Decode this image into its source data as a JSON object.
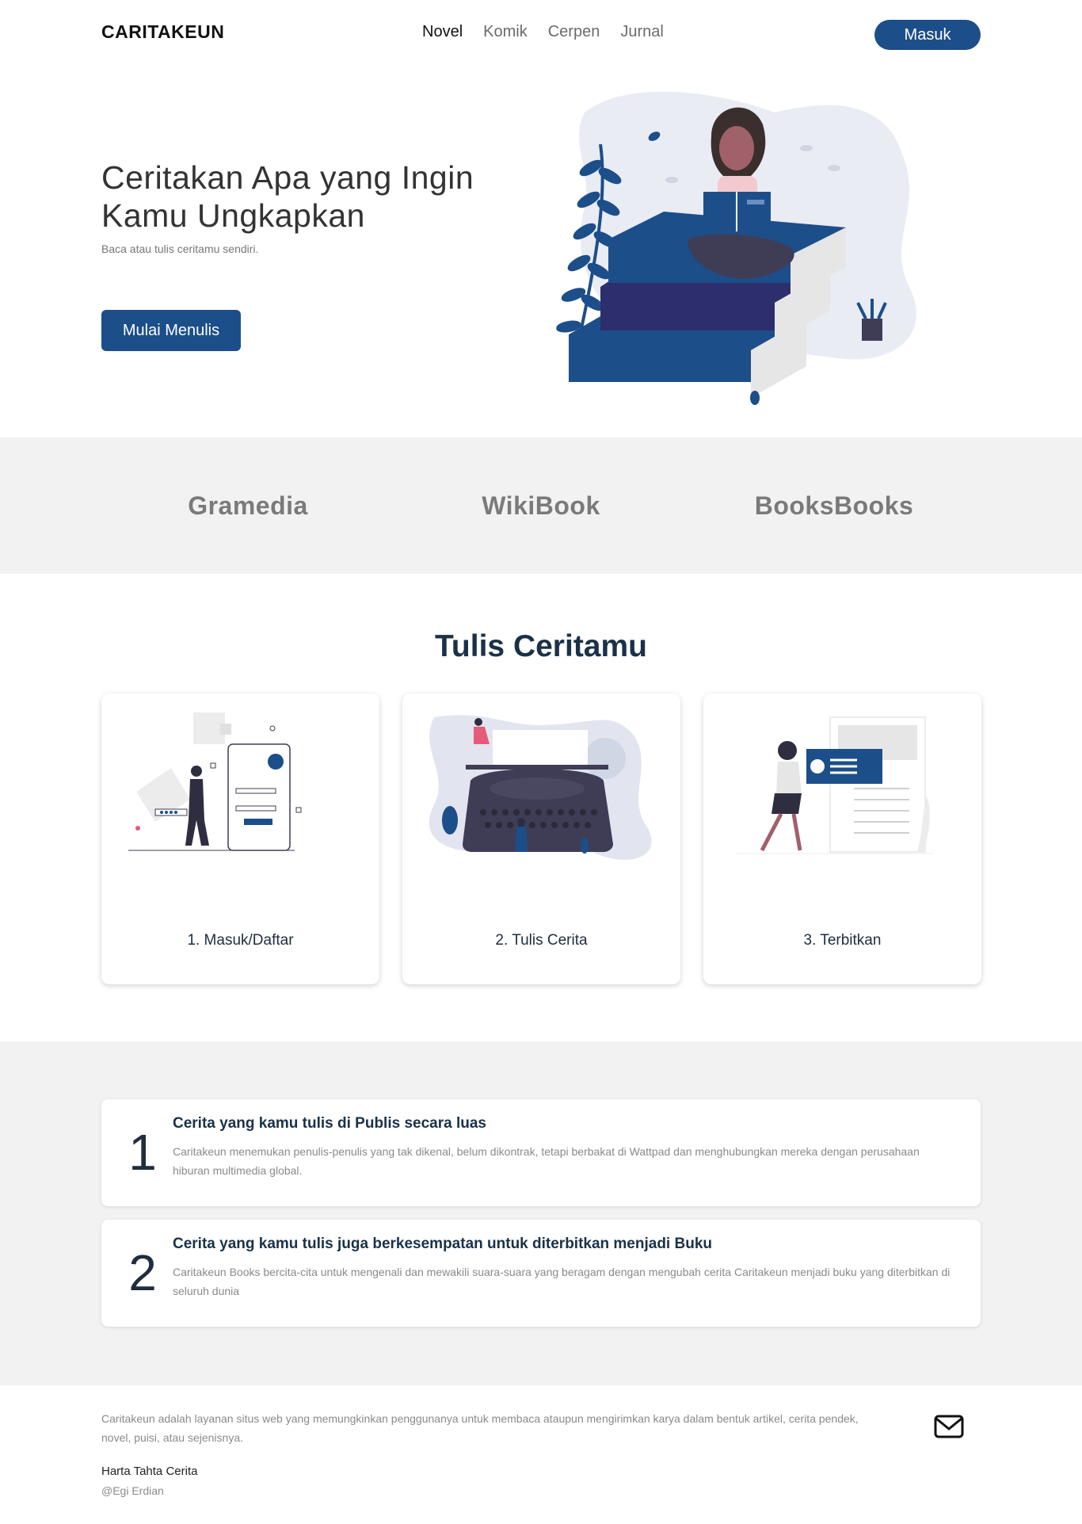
{
  "nav": {
    "brand": "CARITAKEUN",
    "links": [
      "Novel",
      "Komik",
      "Cerpen",
      "Jurnal"
    ],
    "login_label": "Masuk"
  },
  "hero": {
    "title_line1": "Ceritakan Apa yang Ingin",
    "title_line2": "Kamu Ungkapkan",
    "subtitle": "Baca atau tulis ceritamu sendiri.",
    "cta_label": "Mulai Menulis"
  },
  "partners": [
    "Gramedia",
    "WikiBook",
    "BooksBooks"
  ],
  "steps": {
    "title": "Tulis Ceritamu",
    "items": [
      {
        "label": "1. Masuk/Daftar"
      },
      {
        "label": "2. Tulis Cerita"
      },
      {
        "label": "3. Terbitkan"
      }
    ]
  },
  "features": [
    {
      "number": "1",
      "title": "Cerita yang kamu tulis di Publis secara luas",
      "text": "Caritakeun menemukan penulis-penulis yang tak dikenal, belum dikontrak, tetapi berbakat di Wattpad dan menghubungkan mereka dengan perusahaan hiburan multimedia global."
    },
    {
      "number": "2",
      "title": "Cerita yang kamu tulis juga berkesempatan untuk diterbitkan menjadi Buku",
      "text": "Caritakeun Books bercita-cita untuk mengenali dan mewakili suara-suara yang beragam dengan mengubah cerita Caritakeun menjadi buku yang diterbitkan di seluruh dunia"
    }
  ],
  "footer": {
    "description": "Caritakeun adalah layanan situs web yang memungkinkan penggunanya untuk membaca ataupun mengirimkan karya dalam bentuk artikel, cerita pendek, novel, puisi, atau sejenisnya.",
    "team": "Harta Tahta Cerita",
    "author": "@Egi Erdian",
    "icon": "mail-icon"
  },
  "colors": {
    "primary": "#1c4e8a",
    "dark_text": "#1a3148",
    "section_bg": "#f2f2f2"
  }
}
